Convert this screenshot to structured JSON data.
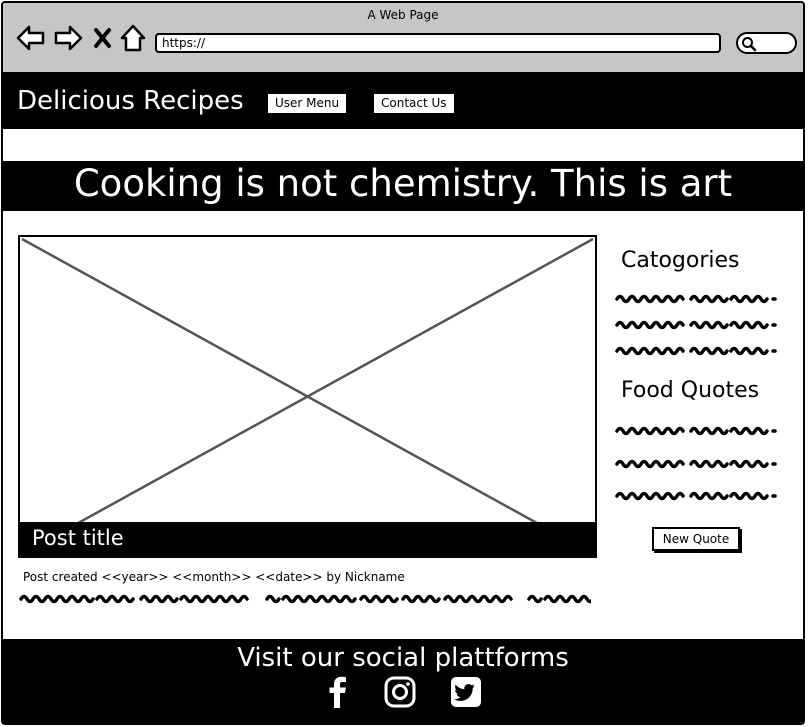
{
  "window": {
    "title": "A Web Page"
  },
  "address_bar": {
    "url": "https://"
  },
  "header": {
    "brand": "Delicious Recipes",
    "buttons": [
      "User Menu",
      "Contact Us"
    ]
  },
  "banner": {
    "text": "Cooking is not chemistry. This is art"
  },
  "post": {
    "title": "Post title",
    "meta": "Post created  <<year>> <<month>> <<date>> by Nickname"
  },
  "sidebar": {
    "categories_heading": "Catogories",
    "quotes_heading": "Food Quotes",
    "new_quote_label": "New Quote"
  },
  "footer": {
    "title": "Visit our social plattforms",
    "icons": [
      "facebook-icon",
      "instagram-icon",
      "twitter-icon"
    ]
  }
}
